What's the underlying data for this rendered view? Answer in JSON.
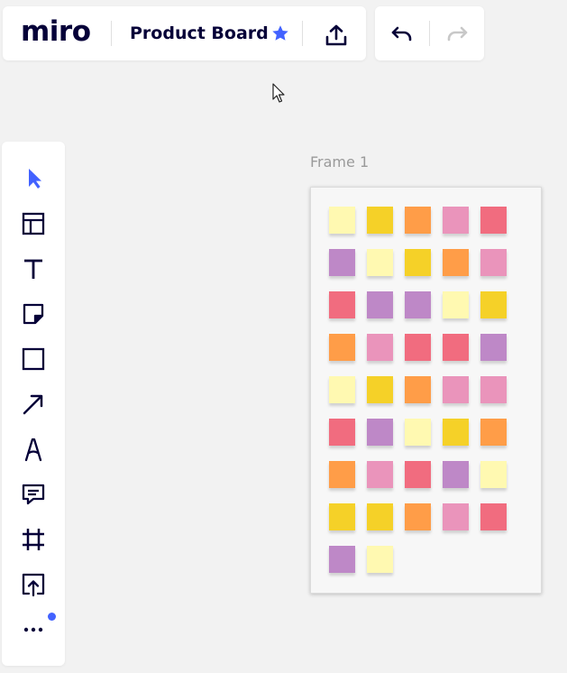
{
  "header": {
    "logo": "miro",
    "board_title": "Product Board"
  },
  "icons": {
    "star": "star-icon",
    "share": "upload-share-icon",
    "undo": "undo-icon",
    "redo": "redo-icon"
  },
  "colors": {
    "accent": "#4262ff",
    "ink": "#050038",
    "disabled": "#c8c8c8"
  },
  "toolbar": {
    "tools": [
      {
        "id": "select",
        "icon": "pointer-arrow-icon",
        "active": true
      },
      {
        "id": "templates",
        "icon": "layout-template-icon"
      },
      {
        "id": "text",
        "icon": "text-icon"
      },
      {
        "id": "sticky-note",
        "icon": "sticky-note-icon"
      },
      {
        "id": "shape",
        "icon": "square-shape-icon"
      },
      {
        "id": "connection-line",
        "icon": "arrow-line-icon"
      },
      {
        "id": "pen",
        "icon": "pen-icon"
      },
      {
        "id": "comment",
        "icon": "comment-icon"
      },
      {
        "id": "frame",
        "icon": "frame-icon"
      },
      {
        "id": "upload",
        "icon": "upload-icon"
      },
      {
        "id": "more",
        "icon": "more-dots-icon",
        "badge": true
      }
    ]
  },
  "frame": {
    "label": "Frame 1",
    "sticky_rows": [
      [
        "#fff9b1",
        "#f5d128",
        "#ff9d48",
        "#ea94bb",
        "#f16c7f"
      ],
      [
        "#be88c7",
        "#fff9b1",
        "#f5d128",
        "#ff9d48",
        "#ea94bb"
      ],
      [
        "#f16c7f",
        "#be88c7",
        "#be88c7",
        "#fff9b1",
        "#f5d128"
      ],
      [
        "#ff9d48",
        "#ea94bb",
        "#f16c7f",
        "#f16c7f",
        "#be88c7"
      ],
      [
        "#fff9b1",
        "#f5d128",
        "#ff9d48",
        "#ea94bb",
        "#ea94bb"
      ],
      [
        "#f16c7f",
        "#be88c7",
        "#fff9b1",
        "#f5d128",
        "#ff9d48"
      ],
      [
        "#ff9d48",
        "#ea94bb",
        "#f16c7f",
        "#be88c7",
        "#fff9b1"
      ],
      [
        "#f5d128",
        "#f5d128",
        "#ff9d48",
        "#ea94bb",
        "#f16c7f"
      ],
      [
        "#be88c7",
        "#fff9b1"
      ]
    ]
  }
}
